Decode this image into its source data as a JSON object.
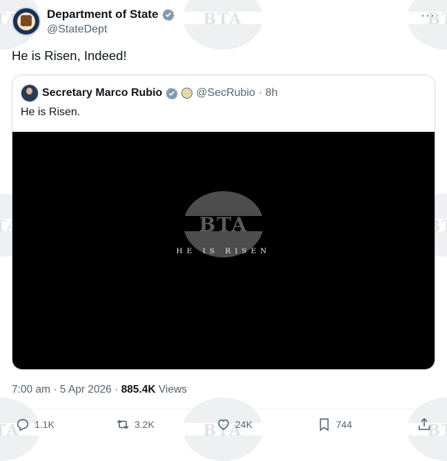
{
  "author": {
    "display_name": "Department of State",
    "handle": "@StateDept"
  },
  "tweet_text": "He is Risen, Indeed!",
  "quote": {
    "display_name": "Secretary Marco Rubio",
    "handle": "@SecRubio",
    "time_ago": "· 8h",
    "text": "He is Risen.",
    "video_title": "HE IS RISEN",
    "video_watermark": "BTA"
  },
  "meta": {
    "time": "7:00 am",
    "date": "5 Apr 2026",
    "views_count": "885.4K",
    "views_label": "Views"
  },
  "actions": {
    "replies": "1.1K",
    "reposts": "3.2K",
    "likes": "24K",
    "bookmarks": "744"
  },
  "watermark_text": "BTA",
  "colors": {
    "verified": "#829aab",
    "text": "#0f1419",
    "secondary": "#536471",
    "border": "#cfd9de"
  }
}
